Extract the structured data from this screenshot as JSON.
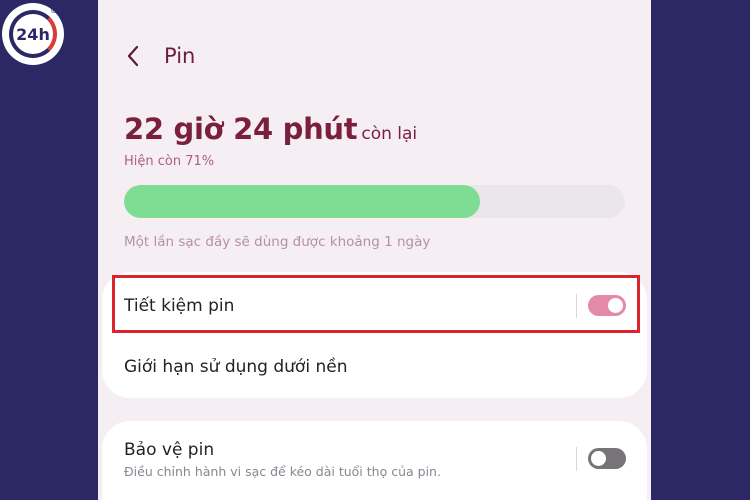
{
  "header": {
    "title": "Pin"
  },
  "battery": {
    "time_remaining": "22 giờ 24 phút",
    "remaining_suffix": "còn lại",
    "percent_text": "Hiện còn 71%",
    "level": 0.71,
    "fill_color": "#7edc93",
    "estimate_text": "Một lần sạc đầy sẽ dùng được khoảng 1 ngày"
  },
  "settings": {
    "power_saving": {
      "label": "Tiết kiệm pin",
      "enabled": true
    },
    "background_limits": {
      "label": "Giới hạn sử dụng dưới nền"
    },
    "battery_protection": {
      "label": "Bảo vệ pin",
      "description": "Điều chỉnh hành vi sạc để kéo dài tuổi thọ của pin.",
      "enabled": false
    }
  },
  "logo": {
    "text": "24h",
    "mark": "®"
  },
  "colors": {
    "background": "#2b2865",
    "accent": "#7a1f3e",
    "toggle_on": "#e48aa6",
    "highlight_border": "#d9262b"
  },
  "icons": {
    "back": "chevron-left-icon"
  }
}
